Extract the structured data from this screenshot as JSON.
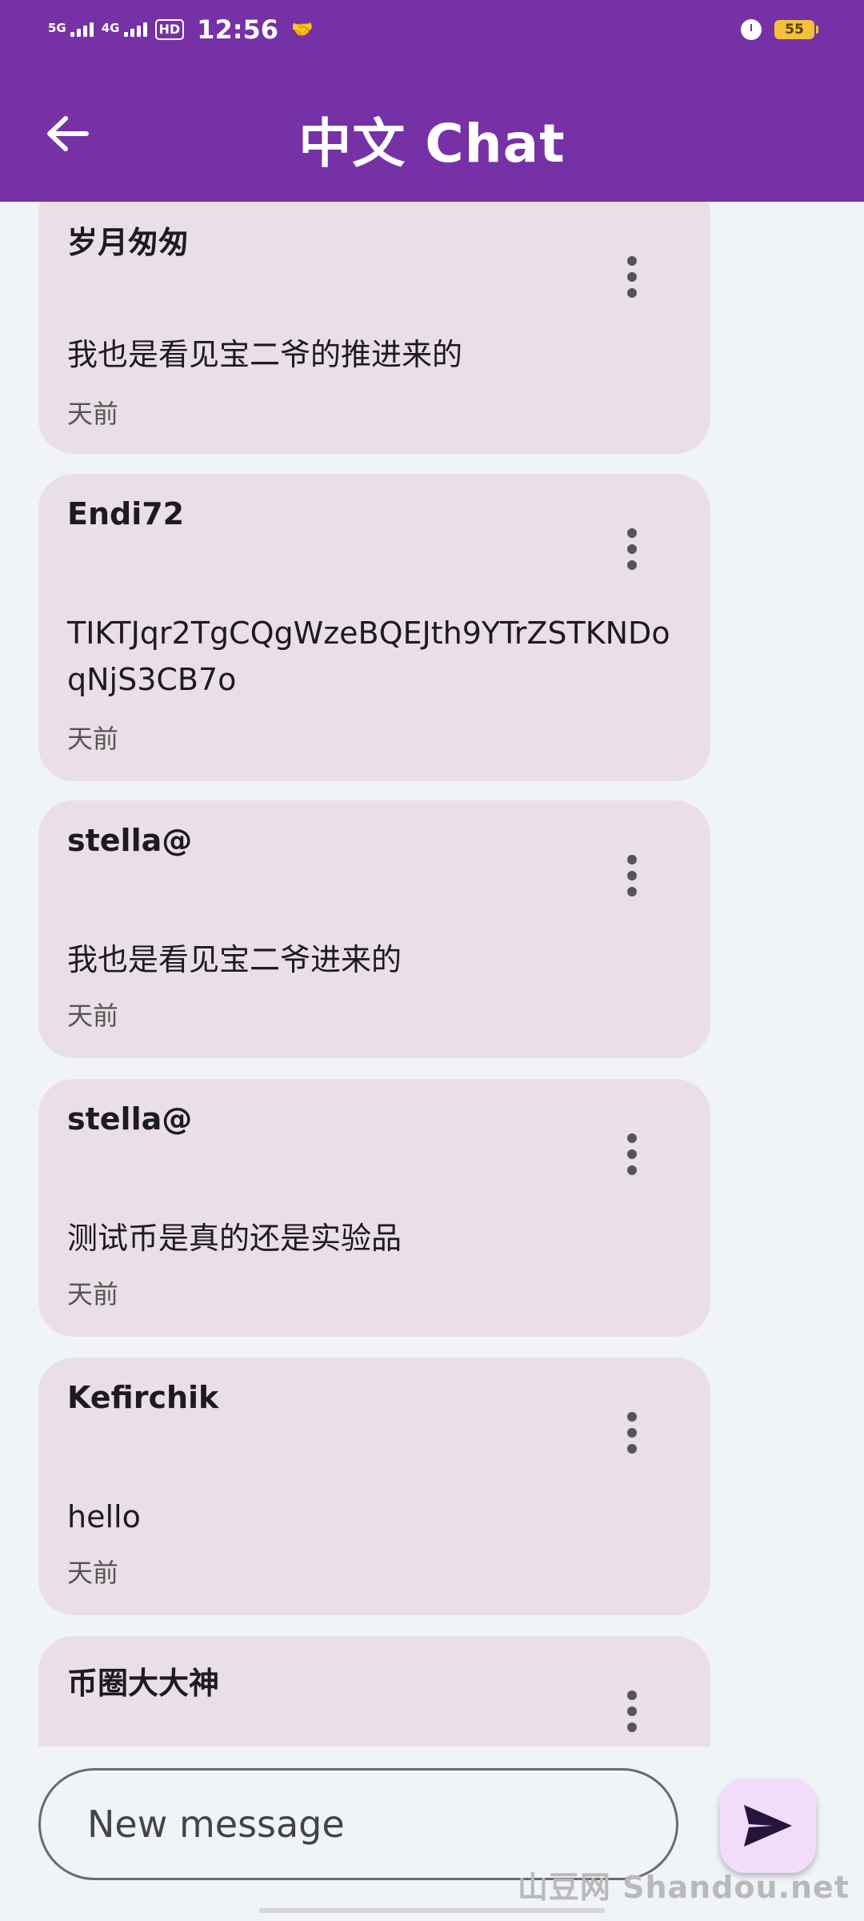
{
  "status_bar": {
    "network1": "5G",
    "network2": "4G",
    "hd": "HD",
    "time": "12:56",
    "battery": "55"
  },
  "app_bar": {
    "title": "中文 Chat"
  },
  "messages": [
    {
      "author": "岁月匆匆",
      "text": "我也是看见宝二爷的推进来的",
      "time": "天前"
    },
    {
      "author": "Endi72",
      "text": "TIKTJqr2TgCQgWzeBQEJth9YTrZSTKNDoqNjS3CB7o",
      "time": "天前"
    },
    {
      "author": "stella@",
      "text": "我也是看见宝二爷进来的",
      "time": "天前"
    },
    {
      "author": "stella@",
      "text": "测试币是真的还是实验品",
      "time": "天前"
    },
    {
      "author": "Kefirchik",
      "text": "hello",
      "time": "天前"
    },
    {
      "author": "币圈大大神",
      "text": "",
      "time": ""
    }
  ],
  "composer": {
    "placeholder": "New message"
  },
  "watermark": "山豆网 Shandou.net",
  "colors": {
    "primary": "#7631a6",
    "card": "#eadfe6",
    "background": "#f0f4f8",
    "send_button": "#f1dcf9"
  }
}
